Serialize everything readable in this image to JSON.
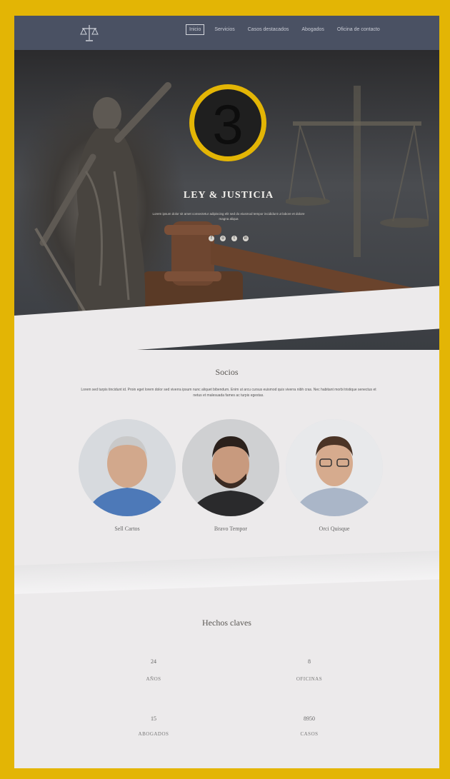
{
  "nav": {
    "items": [
      {
        "label": "Inicio"
      },
      {
        "label": "Servicios"
      },
      {
        "label": "Casos destacados"
      },
      {
        "label": "Abogados"
      },
      {
        "label": "Oficina de contacto"
      }
    ]
  },
  "hero": {
    "badge_number": "3",
    "title": "LEY & JUSTICIA",
    "subtitle": "Lorem ipsum dolor sit amet consectetur adipiscing elit sed do eiusmod tempor incididunt ut labore et dolore magna aliqua",
    "social": [
      "f",
      "o",
      "t",
      "in"
    ]
  },
  "socios": {
    "title": "Socios",
    "text": "Lorem sed turpis tincidunt id. Proin eget lorem dolor sed viverra ipsum nunc aliquet bibendum. Enim ut arcu cursus euismod quis viverra nibh cras. Nec habitant morbi tristique senectus et netus et malesuada fames ac turpis egestas.",
    "partners": [
      {
        "name": "Sell Cartos"
      },
      {
        "name": "Bravo Tempor"
      },
      {
        "name": "Orci Quisque"
      }
    ]
  },
  "hechos": {
    "title": "Hechos claves",
    "facts": [
      {
        "number": "24",
        "label": "AÑOS"
      },
      {
        "number": "8",
        "label": "OFICINAS"
      },
      {
        "number": "15",
        "label": "ABOGADOS"
      },
      {
        "number": "8950",
        "label": "CASOS"
      }
    ]
  },
  "colors": {
    "frame": "#e3b505",
    "nav": "#4a5163",
    "page_bg": "#eceaeb"
  }
}
